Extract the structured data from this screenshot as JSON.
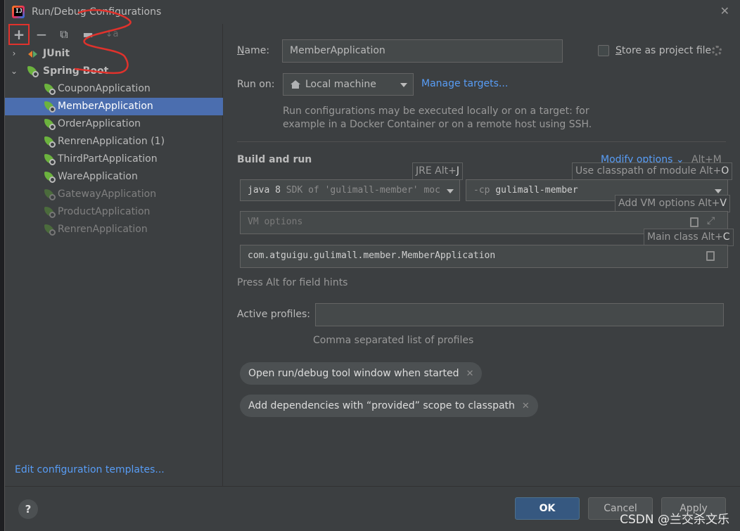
{
  "window": {
    "title": "Run/Debug Configurations",
    "close_label": "✕"
  },
  "toolbar": {
    "add": "+",
    "remove": "−",
    "copy": "⧉",
    "folder": "▬",
    "sort": "↓a"
  },
  "tree": {
    "groups": [
      {
        "label": "JUnit",
        "expanded": false,
        "chevron": "›"
      },
      {
        "label": "Spring Boot",
        "expanded": true,
        "chevron": "⌄"
      }
    ],
    "items": [
      {
        "label": "CouponApplication",
        "selected": false,
        "dimmed": false
      },
      {
        "label": "MemberApplication",
        "selected": true,
        "dimmed": false
      },
      {
        "label": "OrderApplication",
        "selected": false,
        "dimmed": false
      },
      {
        "label": "RenrenApplication (1)",
        "selected": false,
        "dimmed": false
      },
      {
        "label": "ThirdPartApplication",
        "selected": false,
        "dimmed": false
      },
      {
        "label": "WareApplication",
        "selected": false,
        "dimmed": false
      },
      {
        "label": "GatewayApplication",
        "selected": false,
        "dimmed": true
      },
      {
        "label": "ProductApplication",
        "selected": false,
        "dimmed": true
      },
      {
        "label": "RenrenApplication",
        "selected": false,
        "dimmed": true
      }
    ],
    "edit_templates_link": "Edit configuration templates..."
  },
  "form": {
    "name_label_mnemonic": "N",
    "name_label_rest": "ame:",
    "name_value": "MemberApplication",
    "store_label_mnemonic": "S",
    "store_label_rest": "tore as project file",
    "store_checked": false,
    "run_on_label": "Run on:",
    "run_on_value": "Local machine",
    "manage_targets": "Manage targets...",
    "run_on_hint_line1": "Run configurations may be executed locally or on a target: for",
    "run_on_hint_line2": "example in a Docker Container or on a remote host using SSH.",
    "build_and_run": "Build and run",
    "modify_options": "Modify options",
    "modify_shortcut": "Alt+M",
    "jre_tooltip_text": "JRE Alt+",
    "jre_tooltip_key": "J",
    "classpath_tooltip_text": "Use classpath of module Alt+",
    "classpath_tooltip_key": "O",
    "vm_tooltip_text": "Add VM options Alt+",
    "vm_tooltip_key": "V",
    "main_tooltip_text": "Main class Alt+",
    "main_tooltip_key": "C",
    "jre_value_prefix": "java 8",
    "jre_value_rest": "SDK of 'gulimall-member' moc",
    "cp_prefix": "-cp",
    "cp_value": "gulimall-member",
    "vm_placeholder": "VM options",
    "main_class_value": "com.atguigu.gulimall.member.MemberApplication",
    "field_hints": "Press Alt for field hints",
    "active_profiles_label": "Active profiles:",
    "active_profiles_value": "",
    "active_profiles_hint": "Comma separated list of profiles",
    "chip1": "Open run/debug tool window when started",
    "chip2": "Add dependencies with “provided” scope to classpath",
    "chip_close": "✕"
  },
  "buttons": {
    "help": "?",
    "ok": "OK",
    "cancel": "Cancel",
    "apply": "Apply"
  },
  "watermark": "CSDN @兰交杀文乐",
  "colors": {
    "accent_link": "#589df6",
    "selection": "#4b6eaf",
    "annotation_red": "#e0322c",
    "spring_green": "#6cb33e",
    "primary_button": "#365880"
  }
}
